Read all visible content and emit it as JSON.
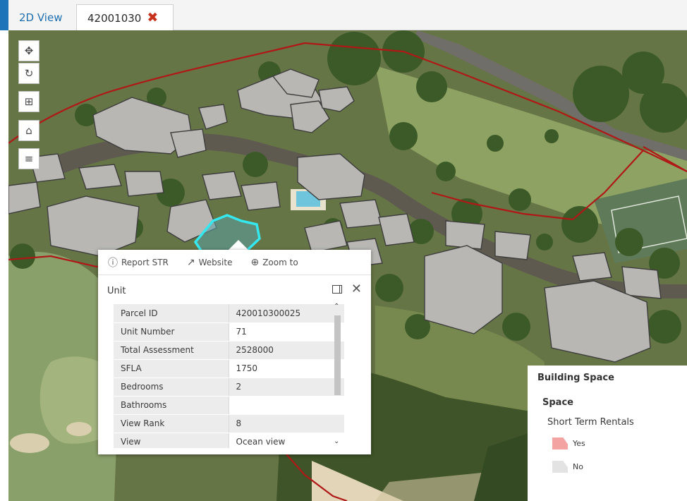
{
  "tabs": [
    {
      "label": "2D View",
      "active": false
    },
    {
      "label": "42001030",
      "active": true,
      "close_icon": "close-x-icon"
    }
  ],
  "map_tools": [
    {
      "name": "pan-icon",
      "glyph": "✥"
    },
    {
      "name": "rotate-icon",
      "glyph": "↻"
    },
    {
      "name": "basemap-gallery-icon",
      "glyph": "⊞"
    },
    {
      "name": "home-icon",
      "glyph": "⌂"
    },
    {
      "name": "layer-list-icon",
      "glyph": "≡"
    }
  ],
  "popup": {
    "actions": [
      {
        "icon": "info-icon",
        "glyph": "ⓘ",
        "label": "Report STR"
      },
      {
        "icon": "external-link-icon",
        "glyph": "↗",
        "label": "Website"
      },
      {
        "icon": "zoom-to-icon",
        "glyph": "⊕",
        "label": "Zoom to"
      }
    ],
    "title": "Unit",
    "rows": [
      {
        "key": "Parcel ID",
        "value": "420010300025"
      },
      {
        "key": "Unit Number",
        "value": "71"
      },
      {
        "key": "Total Assessment",
        "value": "2528000"
      },
      {
        "key": "SFLA",
        "value": "1750"
      },
      {
        "key": "Bedrooms",
        "value": "2"
      },
      {
        "key": "Bathrooms",
        "value": ""
      },
      {
        "key": "View Rank",
        "value": "8"
      },
      {
        "key": "View",
        "value": "Ocean view"
      }
    ]
  },
  "legend": {
    "title": "Building Space",
    "layer": "Space",
    "field": "Short Term Rentals",
    "items": [
      {
        "label": "Yes",
        "color": "#f4a3a3"
      },
      {
        "label": "No",
        "color": "#e3e3e3"
      }
    ]
  },
  "colors": {
    "accent": "#1e74b8",
    "close": "#c8321c",
    "parcel_line": "#b01818",
    "selected": "#35e8ef"
  }
}
